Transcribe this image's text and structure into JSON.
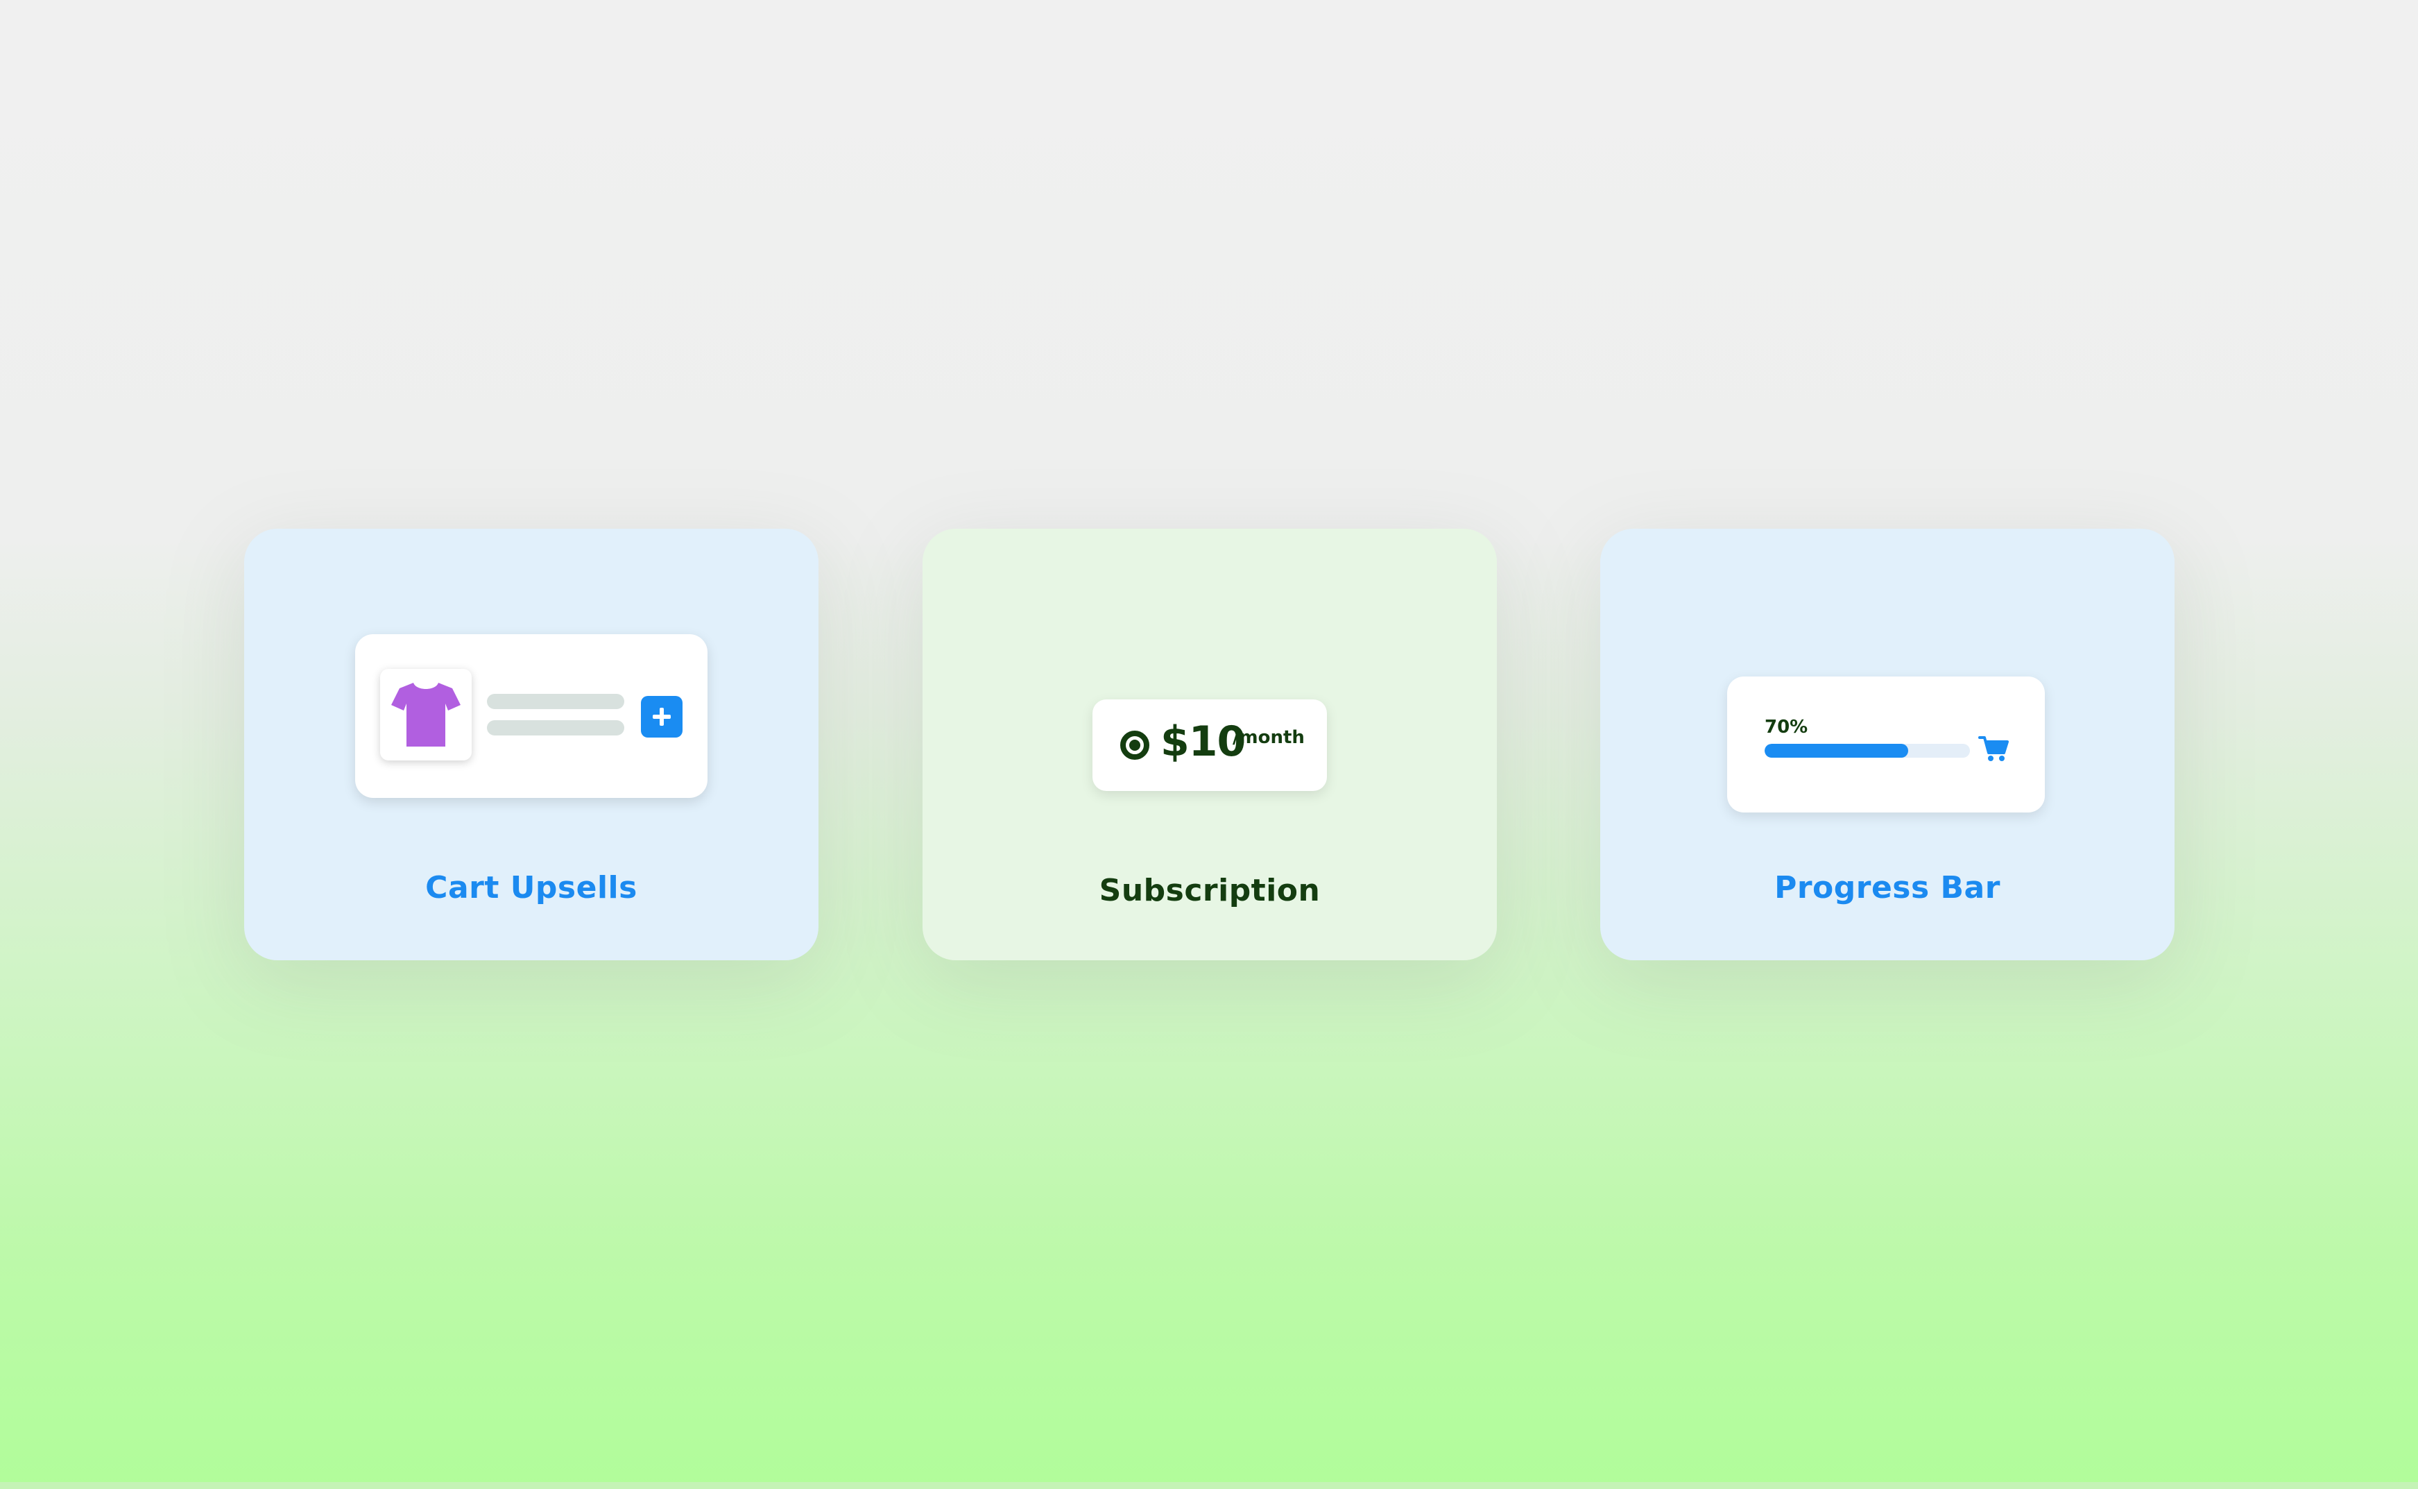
{
  "cards": [
    {
      "id": "cart-upsells",
      "title": "Cart Upsells"
    },
    {
      "id": "subscription",
      "title": "Subscription"
    },
    {
      "id": "progress-bar",
      "title": "Progress Bar"
    }
  ],
  "subscription_widget": {
    "price": "$10",
    "period": "/month",
    "radio_selected": true
  },
  "progress_widget": {
    "percent_label": "70%",
    "progress": 0.7,
    "icon": "cart-icon"
  },
  "upsell_widget": {
    "product_icon": "tshirt-icon",
    "action_icon": "plus-icon"
  },
  "colors": {
    "accent_blue": "#1a8cf2",
    "dark_green": "#143d10",
    "tshirt_purple": "#b15fe0",
    "card_blue": "#e1f0fb",
    "card_green": "#e7f6e4"
  }
}
